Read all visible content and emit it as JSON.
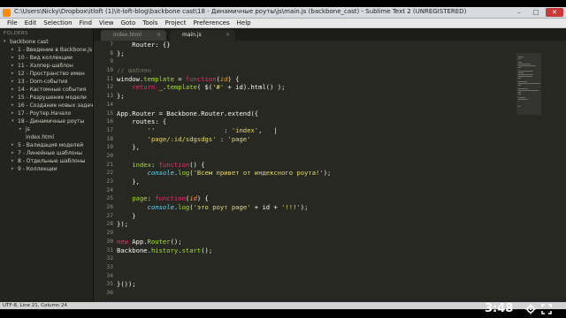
{
  "window": {
    "title": "C:\\Users\\Nicky\\Dropbox\\itloft (1)\\it-loft-blog\\backbone cast\\18 - Динамичные роуты\\js\\main.js (backbone_cast) - Sublime Text 2 (UNREGISTERED)",
    "minimize": "–",
    "maximize": "□",
    "close": "✕"
  },
  "menu": [
    "File",
    "Edit",
    "Selection",
    "Find",
    "View",
    "Goto",
    "Tools",
    "Project",
    "Preferences",
    "Help"
  ],
  "sidebar": {
    "header": "FOLDERS",
    "items": [
      {
        "label": "backbone cast",
        "arrow": "▾",
        "depth": 0
      },
      {
        "label": "1 - Введение в Backbone.js",
        "arrow": "▸",
        "depth": 1
      },
      {
        "label": "10 - Вид коллекции",
        "arrow": "▸",
        "depth": 1
      },
      {
        "label": "11 - Хэлпер-шаблон",
        "arrow": "▸",
        "depth": 1
      },
      {
        "label": "12 - Пространство имен",
        "arrow": "▸",
        "depth": 1
      },
      {
        "label": "13 - Dom-события",
        "arrow": "▸",
        "depth": 1
      },
      {
        "label": "14 - Кастомные события",
        "arrow": "▸",
        "depth": 1
      },
      {
        "label": "15 - Разрушение модели",
        "arrow": "▸",
        "depth": 1
      },
      {
        "label": "16 - Создание новых задач",
        "arrow": "▸",
        "depth": 1
      },
      {
        "label": "17 - Роутер.Начало",
        "arrow": "▸",
        "depth": 1
      },
      {
        "label": "18 - Динамичные роуты",
        "arrow": "▾",
        "depth": 1
      },
      {
        "label": "js",
        "arrow": "▸",
        "depth": 2
      },
      {
        "label": "index.html",
        "arrow": "",
        "depth": 2
      },
      {
        "label": "5 - Валидация моделей",
        "arrow": "▸",
        "depth": 1
      },
      {
        "label": "7 - Линейные шаблоны",
        "arrow": "▸",
        "depth": 1
      },
      {
        "label": "8 - Отдельные шаблоны",
        "arrow": "▸",
        "depth": 1
      },
      {
        "label": "9 - Коллекции",
        "arrow": "▸",
        "depth": 1
      }
    ]
  },
  "tabs": [
    {
      "label": "index.html",
      "close": "×",
      "active": false
    },
    {
      "label": "main.js",
      "close": "×",
      "active": true
    }
  ],
  "editor": {
    "line_numbers": [
      "7",
      "8",
      "9",
      "10",
      "11",
      "12",
      "13",
      "14",
      "15",
      "16",
      "17",
      "18",
      "19",
      "20",
      "21",
      "22",
      "23",
      "24",
      "25",
      "26",
      "27",
      "28",
      "29",
      "30",
      "31",
      "32",
      "33",
      "34",
      "35",
      "36"
    ],
    "lines": [
      [
        [
          "t",
          "    Router: {}"
        ]
      ],
      [
        [
          "t",
          "};"
        ]
      ],
      [
        [
          "t",
          ""
        ]
      ],
      [
        [
          "c",
          "// шаблон"
        ]
      ],
      [
        [
          "t",
          "window."
        ],
        [
          "f",
          "template"
        ],
        [
          "t",
          " = "
        ],
        [
          "k",
          "function"
        ],
        [
          "t",
          "("
        ],
        [
          "p",
          "id"
        ],
        [
          "t",
          ") {"
        ]
      ],
      [
        [
          "t",
          "    "
        ],
        [
          "k",
          "return"
        ],
        [
          "t",
          " _."
        ],
        [
          "f",
          "template"
        ],
        [
          "t",
          "( $("
        ],
        [
          "s",
          "'#'"
        ],
        [
          "t",
          " + id).html() );"
        ]
      ],
      [
        [
          "t",
          "};"
        ]
      ],
      [
        [
          "t",
          ""
        ]
      ],
      [
        [
          "t",
          "App.Router = Backbone.Router.extend({"
        ]
      ],
      [
        [
          "t",
          "    routes: {"
        ]
      ],
      [
        [
          "t",
          "        "
        ],
        [
          "s",
          "''"
        ],
        [
          "t",
          "                  : "
        ],
        [
          "s",
          "'index'"
        ],
        [
          "t",
          ","
        ]
      ],
      [
        [
          "t",
          "        "
        ],
        [
          "s",
          "'page/:id/sdgsdgs'"
        ],
        [
          "t",
          " : "
        ],
        [
          "s",
          "'page'"
        ]
      ],
      [
        [
          "t",
          "    },"
        ]
      ],
      [
        [
          "t",
          ""
        ]
      ],
      [
        [
          "t",
          "    "
        ],
        [
          "f",
          "index"
        ],
        [
          "t",
          ": "
        ],
        [
          "k",
          "function"
        ],
        [
          "t",
          "() {"
        ]
      ],
      [
        [
          "t",
          "        "
        ],
        [
          "b",
          "console"
        ],
        [
          "t",
          "."
        ],
        [
          "f",
          "log"
        ],
        [
          "t",
          "("
        ],
        [
          "s",
          "'Всем привет от индексного роута!'"
        ],
        [
          "t",
          ");"
        ]
      ],
      [
        [
          "t",
          "    },"
        ]
      ],
      [
        [
          "t",
          ""
        ]
      ],
      [
        [
          "t",
          "    "
        ],
        [
          "f",
          "page"
        ],
        [
          "t",
          ": "
        ],
        [
          "k",
          "function"
        ],
        [
          "t",
          "("
        ],
        [
          "p",
          "id"
        ],
        [
          "t",
          ") {"
        ]
      ],
      [
        [
          "t",
          "        "
        ],
        [
          "b",
          "console"
        ],
        [
          "t",
          "."
        ],
        [
          "f",
          "log"
        ],
        [
          "t",
          "("
        ],
        [
          "s",
          "'это роут page'"
        ],
        [
          "t",
          " + id + "
        ],
        [
          "s",
          "'!!!'"
        ],
        [
          "t",
          ");"
        ]
      ],
      [
        [
          "t",
          "    }"
        ]
      ],
      [
        [
          "t",
          "});"
        ]
      ],
      [
        [
          "t",
          ""
        ]
      ],
      [
        [
          "k",
          "new"
        ],
        [
          "t",
          " App."
        ],
        [
          "f",
          "Router"
        ],
        [
          "t",
          "();"
        ]
      ],
      [
        [
          "t",
          "Backbone."
        ],
        [
          "f",
          "history"
        ],
        [
          "t",
          "."
        ],
        [
          "f",
          "start"
        ],
        [
          "t",
          "();"
        ]
      ],
      [
        [
          "t",
          ""
        ]
      ],
      [
        [
          "t",
          ""
        ]
      ],
      [
        [
          "t",
          ""
        ]
      ],
      [
        [
          "t",
          "}());"
        ]
      ],
      [
        [
          "t",
          ""
        ]
      ]
    ]
  },
  "statusbar": {
    "text": "UTF-8, Line 21, Column 24"
  },
  "video": {
    "time": "3:48",
    "settings_icon": "gear-icon",
    "fullscreen_icon": "fullscreen-icon"
  },
  "colors": {
    "editor_bg": "#272822",
    "keyword": "#f92672",
    "string": "#e6db74",
    "function": "#a6e22e",
    "comment": "#75715e",
    "param": "#fd971f",
    "builtin": "#66d9ef"
  }
}
